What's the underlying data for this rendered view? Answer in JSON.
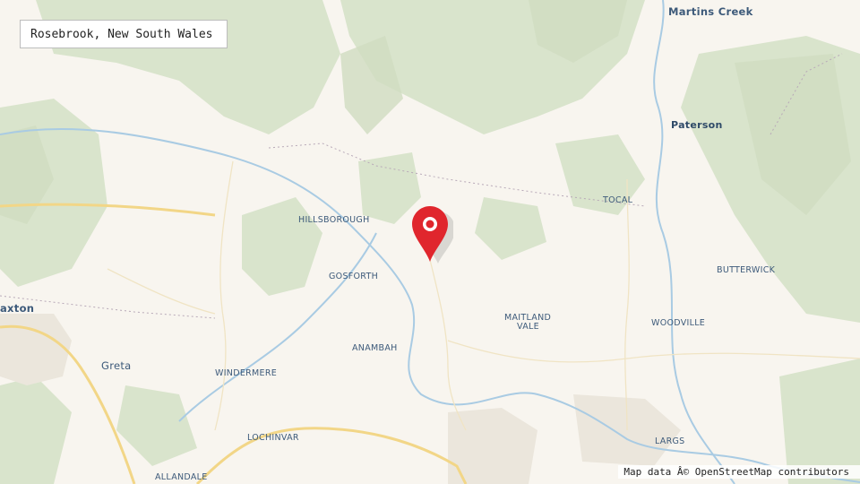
{
  "search": {
    "value": "Rosebrook, New South Wales"
  },
  "places": {
    "martins_creek": "Martins Creek",
    "paterson": "Paterson",
    "tocal": "TOCAL",
    "hillsborough": "HILLSBOROUGH",
    "gosforth": "GOSFORTH",
    "butterwick": "BUTTERWICK",
    "maitland_vale_1": "MAITLAND",
    "maitland_vale_2": "VALE",
    "woodville": "WOODVILLE",
    "anambah": "ANAMBAH",
    "maxton": "axton",
    "greta": "Greta",
    "windermere": "WINDERMERE",
    "lochinvar": "LOCHINVAR",
    "largs": "LARGS",
    "allandale": "ALLANDALE"
  },
  "attribution": "Map data Â© OpenStreetMap contributors",
  "marker": {
    "icon": "map-pin-icon",
    "color": "#e0262d"
  },
  "colors": {
    "land": "#f8f5ef",
    "forest": "#d6e2c8",
    "water": "#a9cbe3",
    "road_major": "#f2d687",
    "road_minor": "#ffffff"
  }
}
